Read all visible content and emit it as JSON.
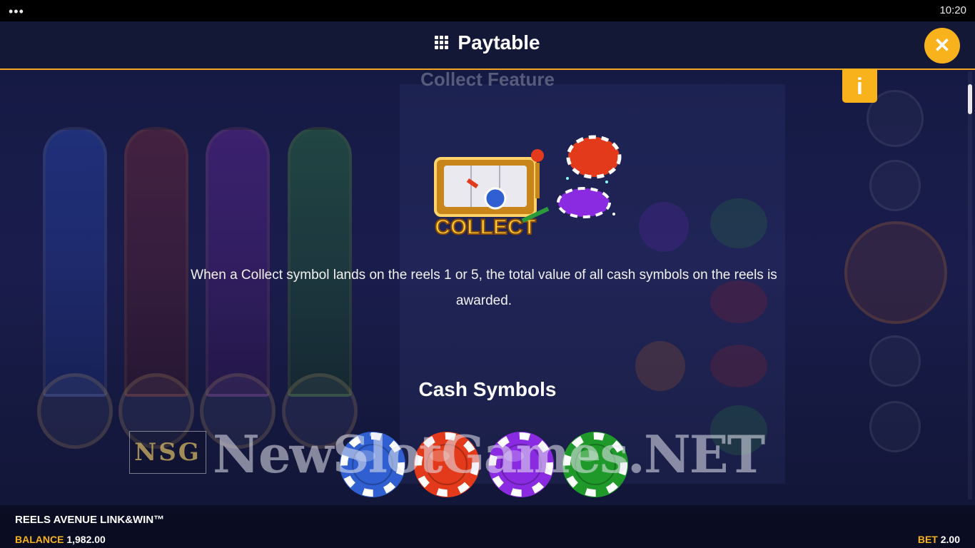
{
  "status_bar": {
    "menu_dots": "•••",
    "time": "10:20"
  },
  "header": {
    "title": "Paytable",
    "close_symbol": "✕",
    "grid_icon": "grid-icon"
  },
  "info_tab": {
    "symbol": "i"
  },
  "content": {
    "section_title": "Collect Feature",
    "collect_label": "COLLECT",
    "collect_description": "When a Collect symbol lands on the reels 1 or 5, the total value of all cash symbols on the reels is awarded.",
    "cash_symbols_title": "Cash Symbols",
    "cash_chips": [
      {
        "color": "#2f5fd0",
        "name": "blue-chip"
      },
      {
        "color": "#e23a1a",
        "name": "red-chip"
      },
      {
        "color": "#8a2be2",
        "name": "purple-chip"
      },
      {
        "color": "#1f9a2a",
        "name": "green-chip"
      }
    ]
  },
  "watermark": {
    "logo_text": "NSG",
    "text": "NewSlotGames.NET"
  },
  "footer": {
    "game_name": "REELS AVENUE LINK&WIN™",
    "balance_label": "BALANCE",
    "balance_value": "1,982.00",
    "bet_label": "BET",
    "bet_value": "2.00"
  },
  "colors": {
    "accent": "#f7b21c",
    "header_bg": "#141837",
    "background": "#0b0f2a"
  }
}
